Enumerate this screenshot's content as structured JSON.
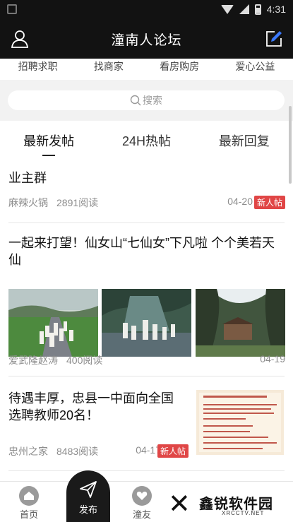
{
  "status_bar": {
    "time": "4:31"
  },
  "header": {
    "title": "潼南人论坛"
  },
  "categories": [
    "招聘求职",
    "找商家",
    "看房购房",
    "爱心公益"
  ],
  "search": {
    "placeholder": "搜索"
  },
  "tabs": [
    {
      "label": "最新发帖",
      "active": true
    },
    {
      "label": "24H热帖",
      "active": false
    },
    {
      "label": "最新回复",
      "active": false
    }
  ],
  "posts": [
    {
      "title": "业主群",
      "author": "麻辣火锅",
      "reads": "2891阅读",
      "date": "04-20",
      "badge": "新人帖"
    },
    {
      "title": "一起来打望！仙女山“七仙女”下凡啦 个个美若天仙",
      "author": "爱武隆赵涛",
      "reads": "400阅读",
      "date": "04-19",
      "badge": ""
    },
    {
      "title": "待遇丰厚，忠县一中面向全国选聘教师20名！",
      "author": "忠州之家",
      "reads": "8483阅读",
      "date": "04-17",
      "badge": "新人帖"
    }
  ],
  "bottom_nav": {
    "home": "首页",
    "publish": "发布",
    "friends": "潼友"
  },
  "watermark": {
    "brand": "鑫锐软件园",
    "url": "XRCCTV.NET"
  }
}
